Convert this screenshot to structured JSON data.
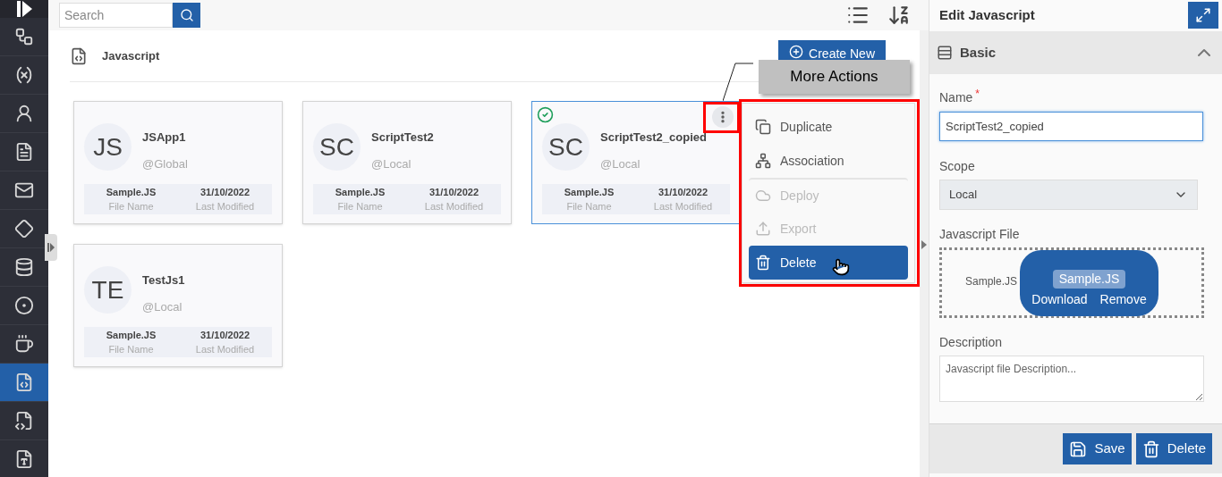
{
  "search": {
    "placeholder": "Search"
  },
  "sidebar": {
    "items": [
      {
        "kind": "flow",
        "selected": false
      },
      {
        "kind": "variable",
        "selected": false
      },
      {
        "kind": "user",
        "selected": false
      },
      {
        "kind": "document",
        "selected": false
      },
      {
        "kind": "mail",
        "selected": false
      },
      {
        "kind": "diamond",
        "selected": false
      },
      {
        "kind": "database",
        "selected": false
      },
      {
        "kind": "circle",
        "selected": false
      },
      {
        "kind": "java",
        "selected": false
      },
      {
        "kind": "js",
        "selected": true
      },
      {
        "kind": "css",
        "selected": false
      },
      {
        "kind": "text",
        "selected": false
      }
    ]
  },
  "page": {
    "title": "Javascript",
    "create_button": "Create New"
  },
  "cards": [
    {
      "initials": "JS",
      "name": "JSApp1",
      "scope": "@Global",
      "file_name": "Sample.JS",
      "file_name_label": "File Name",
      "modified": "31/10/2022",
      "modified_label": "Last Modified",
      "selected": false,
      "menu_open": false
    },
    {
      "initials": "SC",
      "name": "ScriptTest2",
      "scope": "@Local",
      "file_name": "Sample.JS",
      "file_name_label": "File Name",
      "modified": "31/10/2022",
      "modified_label": "Last Modified",
      "selected": false,
      "menu_open": false
    },
    {
      "initials": "SC",
      "name": "ScriptTest2_copied",
      "scope": "@Local",
      "file_name": "Sample.JS",
      "file_name_label": "File Name",
      "modified": "31/10/2022",
      "modified_label": "Last Modified",
      "selected": true,
      "menu_open": true
    },
    {
      "initials": "TE",
      "name": "TestJs1",
      "scope": "@Local",
      "file_name": "Sample.JS",
      "file_name_label": "File Name",
      "modified": "31/10/2022",
      "modified_label": "Last Modified",
      "selected": false,
      "menu_open": false
    }
  ],
  "menu": {
    "items": [
      {
        "kind": "copy",
        "label": "Duplicate",
        "disabled": false,
        "highlighted": false,
        "separator_before": false
      },
      {
        "kind": "tree",
        "label": "Association",
        "disabled": false,
        "highlighted": false,
        "separator_before": false
      },
      {
        "kind": "cloud",
        "label": "Deploy",
        "disabled": true,
        "highlighted": false,
        "separator_before": true
      },
      {
        "kind": "upload",
        "label": "Export",
        "disabled": true,
        "highlighted": false,
        "separator_before": false
      },
      {
        "kind": "trash",
        "label": "Delete",
        "disabled": false,
        "highlighted": true,
        "separator_before": false
      }
    ]
  },
  "callout": {
    "text": "More Actions"
  },
  "editor": {
    "title": "Edit Javascript",
    "section": {
      "title": "Basic",
      "expanded": true
    },
    "name": {
      "label": "Name",
      "required_mark": "*",
      "value": "ScriptTest2_copied"
    },
    "scope": {
      "label": "Scope",
      "value": "Local"
    },
    "file": {
      "label": "Javascript File",
      "name": "Sample.JS",
      "tooltip_name": "Sample.JS",
      "actions": [
        "Download",
        "Remove"
      ]
    },
    "description": {
      "label": "Description",
      "placeholder": "Javascript file Description..."
    },
    "buttons": [
      {
        "kind": "save",
        "label": "Save"
      },
      {
        "kind": "delete",
        "label": "Delete"
      }
    ]
  }
}
